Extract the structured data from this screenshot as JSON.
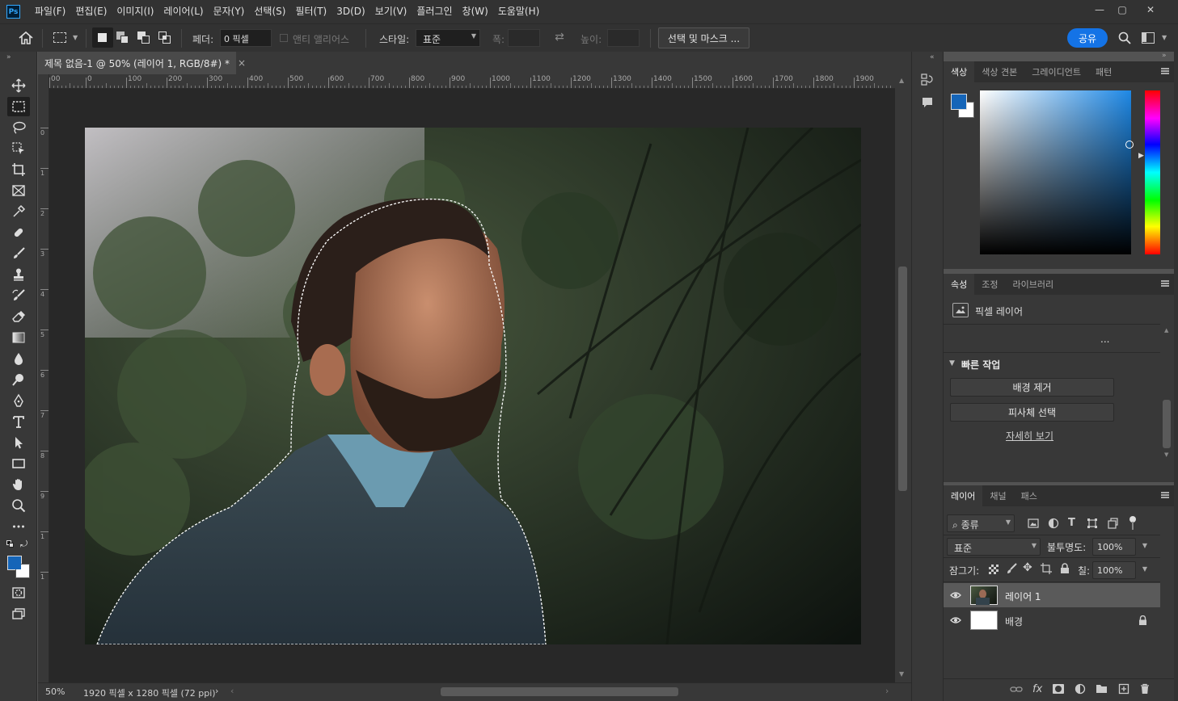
{
  "app": {
    "logo": "Ps"
  },
  "menu": [
    "파일(F)",
    "편집(E)",
    "이미지(I)",
    "레이어(L)",
    "문자(Y)",
    "선택(S)",
    "필터(T)",
    "3D(D)",
    "보기(V)",
    "플러그인",
    "창(W)",
    "도움말(H)"
  ],
  "window_controls": {
    "minimize": "—",
    "maximize": "▢",
    "close": "✕"
  },
  "options": {
    "feather_label": "페더:",
    "feather_value": "0 픽셀",
    "antialias_label": "앤티 앨리어스",
    "style_label": "스타일:",
    "style_value": "표준",
    "width_label": "폭:",
    "height_label": "높이:",
    "select_mask_label": "선택 및 마스크 ...",
    "share_label": "공유"
  },
  "document": {
    "tab_title": "제목 없음-1 @ 50% (레이어 1, RGB/8#) *",
    "close_glyph": "×",
    "ruler_h_labels": [
      "00",
      "0",
      "100",
      "200",
      "300",
      "400",
      "500",
      "600",
      "700",
      "800",
      "900",
      "1000",
      "1100",
      "1200",
      "1300",
      "1400",
      "1500",
      "1600",
      "1700",
      "1800",
      "1900"
    ],
    "ruler_v_labels": [
      "0",
      "1",
      "2",
      "3",
      "4",
      "5",
      "6",
      "7",
      "8",
      "9",
      "1",
      "1"
    ]
  },
  "status": {
    "zoom": "50%",
    "doc_info": "1920 픽셀 x 1280 픽셀 (72 ppi)",
    "arrow": "›"
  },
  "color_panel": {
    "tabs": [
      "색상",
      "색상 견본",
      "그레이디언트",
      "패턴"
    ],
    "foreground": "#1565b8",
    "background": "#ffffff",
    "hue_color": "#1e88e5"
  },
  "properties_panel": {
    "tabs": [
      "속성",
      "조정",
      "라이브러리"
    ],
    "type_label": "픽셀 레이어",
    "more": "...",
    "quick_actions_title": "빠른 작업",
    "remove_bg": "배경 제거",
    "select_subject": "피사체 선택",
    "learn_more": "자세히 보기"
  },
  "layers_panel": {
    "tabs": [
      "레이어",
      "채널",
      "패스"
    ],
    "filter_label": "종류",
    "blend_mode": "표준",
    "opacity_label": "불투명도:",
    "opacity_value": "100%",
    "lock_label": "잠그기:",
    "fill_label": "칠:",
    "fill_value": "100%",
    "layers": [
      {
        "name": "레이어 1",
        "selected": true
      },
      {
        "name": "배경",
        "selected": false
      }
    ],
    "footer_fx": "fx"
  }
}
